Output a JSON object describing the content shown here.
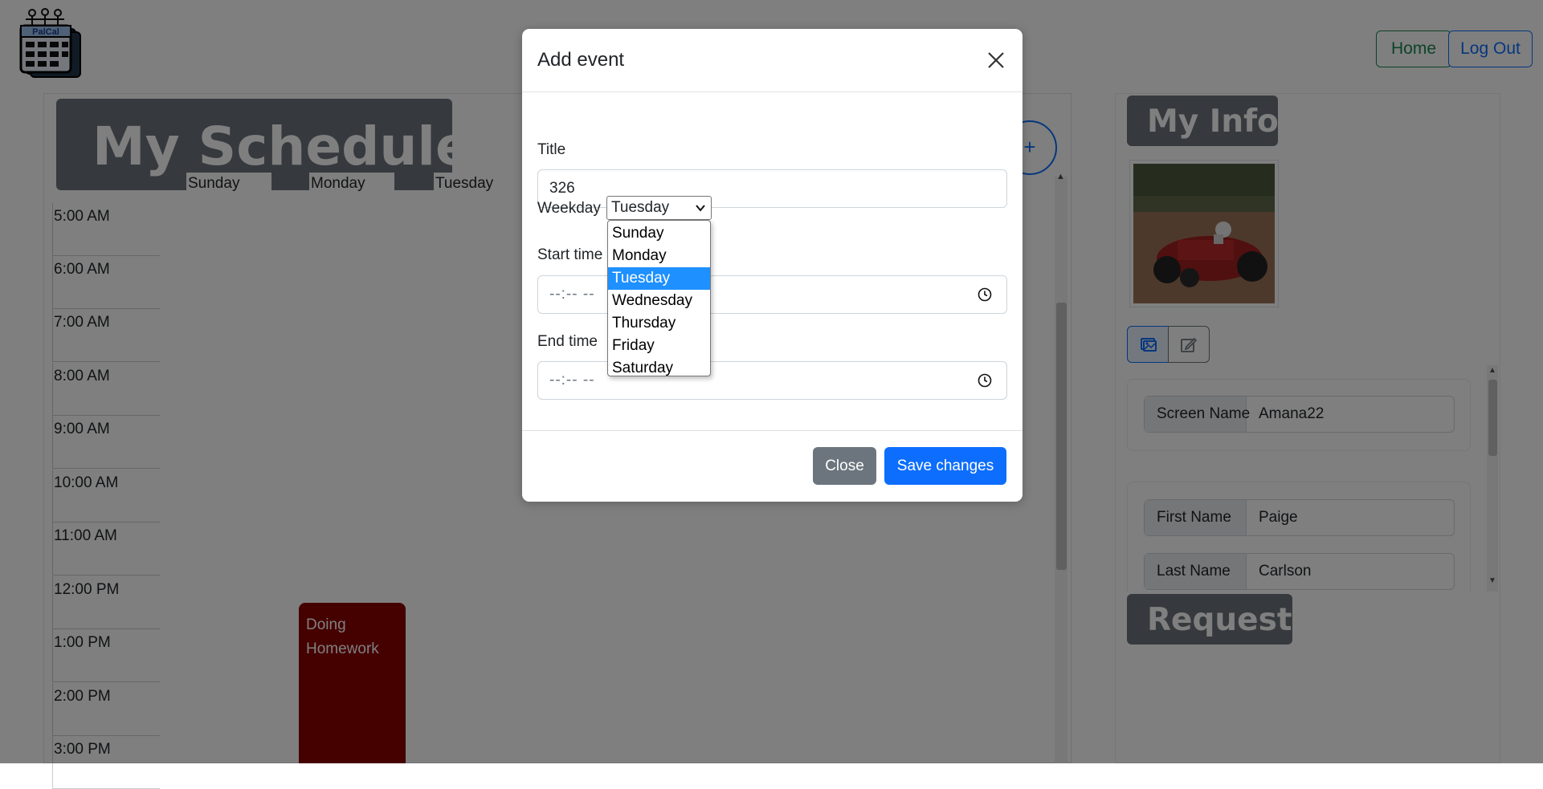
{
  "header": {
    "logo_text": "PalCal",
    "home_label": "Home",
    "logout_label": "Log Out"
  },
  "schedule": {
    "title": "My Schedule",
    "add_label": "+",
    "days": [
      "Sunday",
      "Monday",
      "Tuesday"
    ],
    "times": [
      "5:00 AM",
      "6:00 AM",
      "7:00 AM",
      "8:00 AM",
      "9:00 AM",
      "10:00 AM",
      "11:00 AM",
      "12:00 PM",
      "1:00 PM",
      "2:00 PM",
      "3:00 PM"
    ],
    "event": {
      "line1": "Doing",
      "line2": "Homework",
      "color": "#8b0000"
    }
  },
  "info": {
    "title": "My Info",
    "screen_name_label": "Screen Name",
    "screen_name_value": "Amana22",
    "first_name_label": "First Name",
    "first_name_value": "Paige",
    "last_name_label": "Last Name",
    "last_name_value": "Carlson",
    "requests_title": "Requests"
  },
  "modal": {
    "title": "Add event",
    "title_label": "Title",
    "title_value": "326",
    "weekday_label": "Weekday",
    "weekday_value": "Tuesday",
    "weekday_options": [
      "Sunday",
      "Monday",
      "Tuesday",
      "Wednesday",
      "Thursday",
      "Friday",
      "Saturday"
    ],
    "selected_index": 2,
    "start_label": "Start time",
    "start_placeholder": "--:-- --",
    "end_label": "End time",
    "end_placeholder": "--:-- --",
    "close_label": "Close",
    "save_label": "Save changes"
  },
  "colors": {
    "primary": "#0d6efd",
    "success": "#198754",
    "secondary": "#6c757d",
    "highlight": "#1e90ff"
  },
  "icons": [
    "photo-icon",
    "edit-icon",
    "close-icon",
    "clock-icon",
    "chevron-down-icon"
  ]
}
